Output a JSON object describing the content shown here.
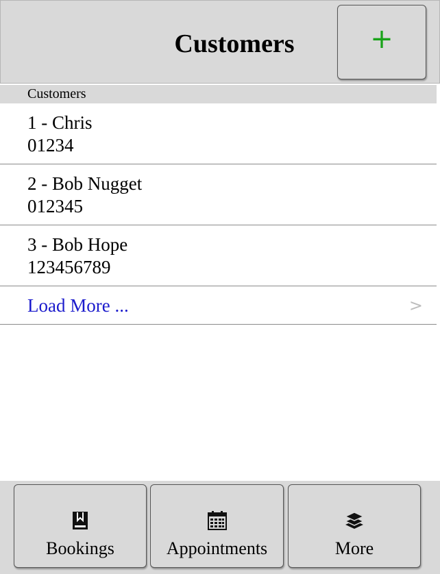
{
  "header": {
    "title": "Customers",
    "add_label": "+"
  },
  "list": {
    "section_title": "Customers",
    "items": [
      {
        "title": "1 - Chris",
        "subtitle": "01234"
      },
      {
        "title": "2 - Bob Nugget",
        "subtitle": "012345"
      },
      {
        "title": "3 - Bob Hope",
        "subtitle": "123456789"
      }
    ],
    "load_more": {
      "label": "Load More ...",
      "chevron": ">"
    }
  },
  "tabbar": {
    "tabs": [
      {
        "label": "Bookings",
        "icon": "book-icon"
      },
      {
        "label": "Appointments",
        "icon": "calendar-icon"
      },
      {
        "label": "More",
        "icon": "layers-icon"
      }
    ]
  },
  "colors": {
    "bar_background": "#d9d9d9",
    "add_accent": "#1aa31a",
    "link": "#1a1acc",
    "divider": "#8a8a8a"
  }
}
